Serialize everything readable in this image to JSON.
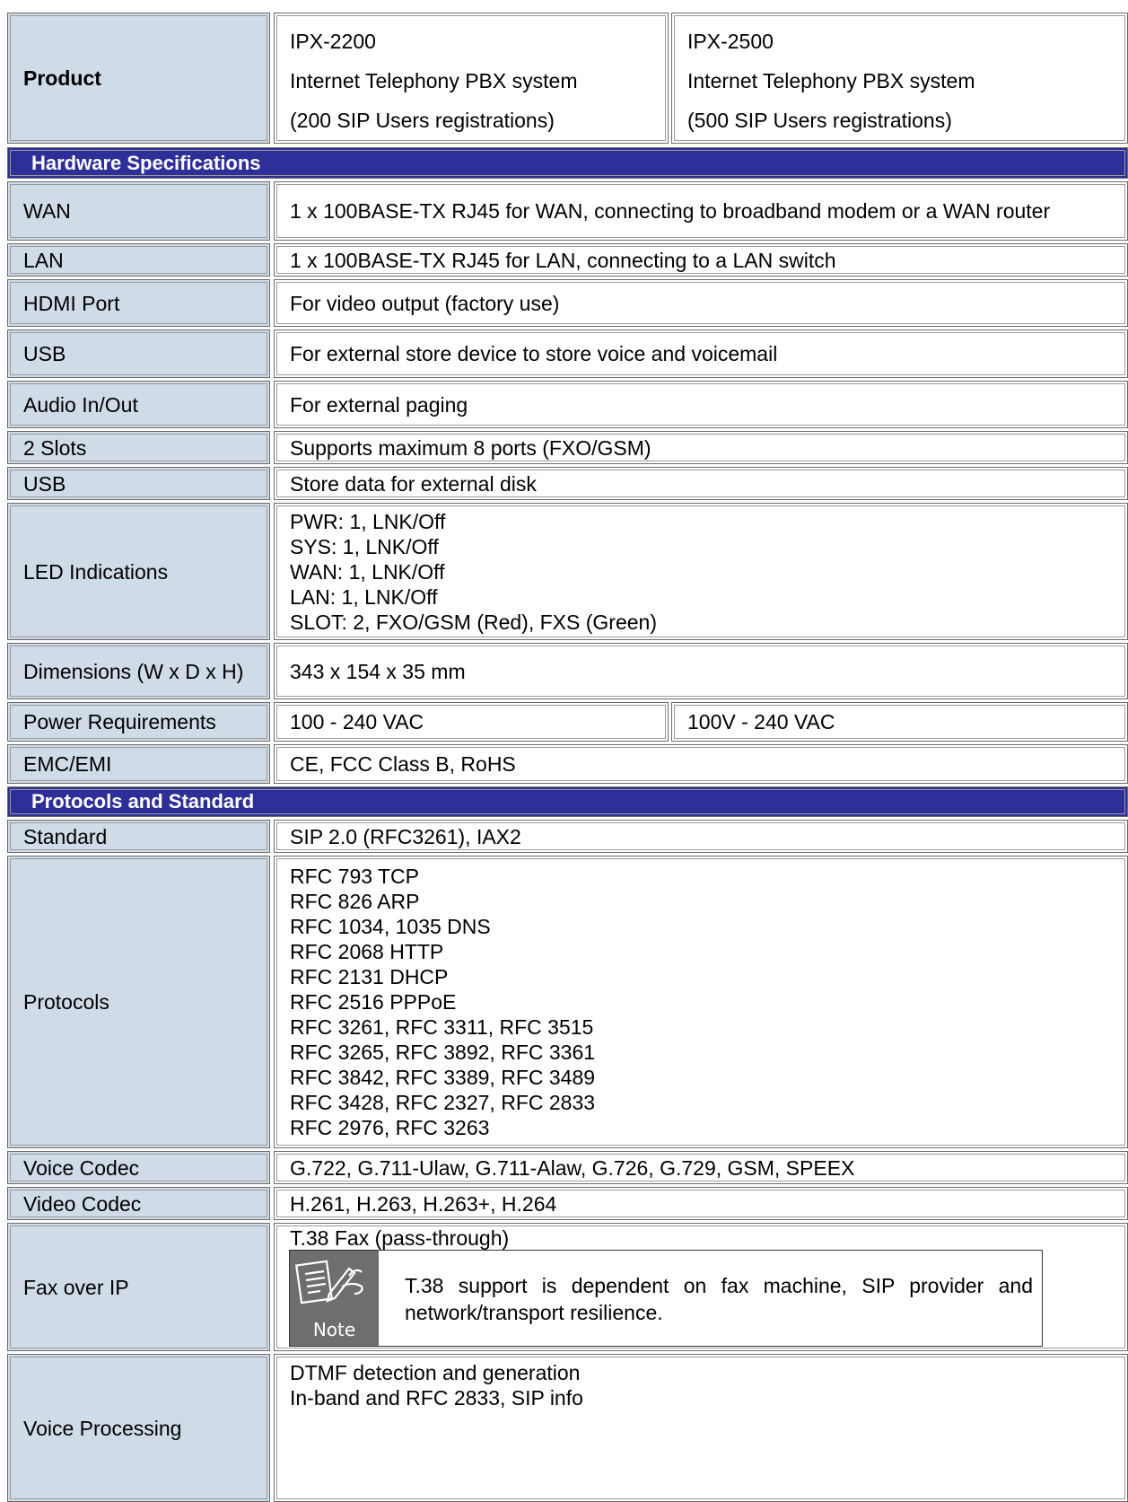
{
  "product": {
    "label": "Product",
    "models": [
      {
        "lines": [
          "IPX-2200",
          "Internet Telephony PBX system",
          "(200 SIP Users registrations)"
        ]
      },
      {
        "lines": [
          "IPX-2500",
          "Internet Telephony PBX system",
          "(500 SIP Users registrations)"
        ]
      }
    ]
  },
  "hardware": {
    "title": "Hardware Specifications",
    "rows": [
      {
        "label": "WAN",
        "value": "1 x 100BASE-TX RJ45 for WAN, connecting to broadband modem or a WAN router"
      },
      {
        "label": "LAN",
        "value": "1 x 100BASE-TX RJ45 for LAN, connecting to a LAN switch"
      },
      {
        "label": "HDMI Port",
        "value": "For video output (factory use)"
      },
      {
        "label": "USB",
        "value": "For external store device to store voice and voicemail"
      },
      {
        "label": "Audio In/Out",
        "value": "For external paging"
      },
      {
        "label": "2 Slots",
        "value": "Supports maximum 8 ports (FXO/GSM)"
      },
      {
        "label": "USB",
        "value": "Store data for external disk"
      },
      {
        "label": "LED Indications",
        "lines": [
          "PWR: 1, LNK/Off",
          "SYS: 1, LNK/Off",
          "WAN: 1, LNK/Off",
          "LAN: 1, LNK/Off",
          "SLOT: 2, FXO/GSM (Red), FXS (Green)"
        ]
      },
      {
        "label": "Dimensions (W x D x H)",
        "value": "343 x 154 x 35 mm"
      },
      {
        "label": "Power Requirements",
        "value": "100 - 240 VAC",
        "value2": "100V - 240 VAC"
      },
      {
        "label": "EMC/EMI",
        "value": "CE, FCC Class B, RoHS"
      }
    ]
  },
  "protocols": {
    "title": "Protocols and Standard",
    "rows": [
      {
        "label": "Standard",
        "value": "SIP 2.0 (RFC3261), IAX2"
      },
      {
        "label": "Protocols",
        "lines": [
          "RFC 793 TCP",
          "RFC 826 ARP",
          "RFC 1034, 1035 DNS",
          "RFC 2068 HTTP",
          "RFC 2131 DHCP",
          "RFC 2516 PPPoE",
          "RFC 3261, RFC 3311, RFC 3515",
          "RFC 3265, RFC 3892, RFC 3361",
          "RFC 3842, RFC 3389, RFC 3489",
          "RFC 3428, RFC 2327, RFC 2833",
          "RFC 2976, RFC 3263"
        ]
      },
      {
        "label": "Voice Codec",
        "value": "G.722, G.711-Ulaw, G.711-Alaw, G.726, G.729, GSM, SPEEX"
      },
      {
        "label": "Video Codec",
        "value": "H.261, H.263, H.263+, H.264"
      },
      {
        "label": "Fax over IP",
        "value": "T.38 Fax (pass-through)",
        "note": {
          "icon_label": "Note",
          "text": "T.38 support is dependent on fax machine, SIP provider and network/transport resilience."
        }
      },
      {
        "label": "Voice Processing",
        "lines": [
          "DTMF detection and generation",
          "In-band and RFC 2833, SIP info"
        ]
      }
    ]
  }
}
